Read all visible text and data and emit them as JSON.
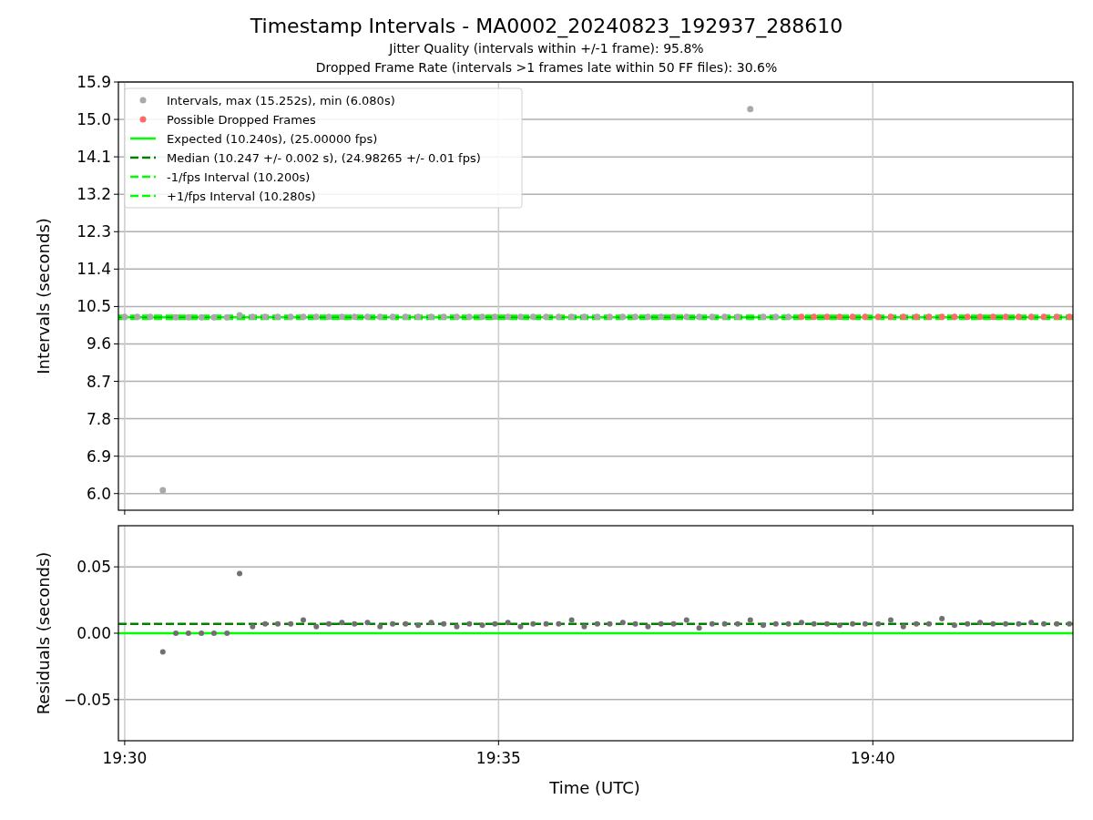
{
  "figure": {
    "title": "Timestamp Intervals - MA0002_20240823_192937_288610",
    "subtitles": [
      "Jitter Quality (intervals within +/-1 frame): 95.8%",
      "Dropped Frame Rate (intervals >1 frames late within 50 FF files): 30.6%"
    ]
  },
  "intervals_plot": {
    "chart_data": {
      "type": "scatter",
      "legend": "upper left",
      "grid": true,
      "ylabel": "Intervals (seconds)",
      "xlim": [
        19.4986,
        19.7113
      ],
      "ylim": [
        5.6,
        15.9
      ],
      "yticks": [
        {
          "value": 6.0,
          "label": "6.0"
        },
        {
          "value": 6.9,
          "label": "6.9"
        },
        {
          "value": 7.8,
          "label": "7.8"
        },
        {
          "value": 8.7,
          "label": "8.7"
        },
        {
          "value": 9.6,
          "label": "9.6"
        },
        {
          "value": 10.5,
          "label": "10.5"
        },
        {
          "value": 11.4,
          "label": "11.4"
        },
        {
          "value": 12.3,
          "label": "12.3"
        },
        {
          "value": 13.2,
          "label": "13.2"
        },
        {
          "value": 14.1,
          "label": "14.1"
        },
        {
          "value": 15.0,
          "label": "15.0"
        },
        {
          "value": 15.9,
          "label": "15.9"
        }
      ],
      "series": [
        {
          "name": "Intervals, max (15.252s), min (6.080s)",
          "color": "#a9a9a9",
          "x": [
            19.5,
            19.5028,
            19.5057,
            19.5085,
            19.5114,
            19.5142,
            19.5171,
            19.5199,
            19.5228,
            19.5256,
            19.5285,
            19.5313,
            19.5341,
            19.537,
            19.5398,
            19.5427,
            19.5455,
            19.5484,
            19.5512,
            19.5541,
            19.5569,
            19.5597,
            19.5626,
            19.5654,
            19.5683,
            19.5711,
            19.574,
            19.5768,
            19.5797,
            19.5825,
            19.5854,
            19.5882,
            19.591,
            19.5939,
            19.5967,
            19.5996,
            19.6024,
            19.6053,
            19.6081,
            19.611,
            19.6138,
            19.6166,
            19.6195,
            19.6223,
            19.6252,
            19.628,
            19.6309,
            19.6337,
            19.6366,
            19.6394,
            19.6423,
            19.6451,
            19.6479
          ],
          "values": [
            10.25,
            10.25,
            10.25,
            6.08,
            10.24,
            10.24,
            10.24,
            10.24,
            10.24,
            10.29,
            10.25,
            10.25,
            10.25,
            10.25,
            10.25,
            10.25,
            10.25,
            10.25,
            10.25,
            10.25,
            10.25,
            10.25,
            10.25,
            10.25,
            10.25,
            10.25,
            10.25,
            10.25,
            10.25,
            10.25,
            10.25,
            10.25,
            10.25,
            10.25,
            10.25,
            10.25,
            10.25,
            10.25,
            10.25,
            10.25,
            10.25,
            10.25,
            10.25,
            10.25,
            10.25,
            10.25,
            10.25,
            10.25,
            10.25,
            15.25,
            10.25,
            10.25,
            10.25
          ]
        },
        {
          "name": "Possible Dropped Frames",
          "color": "#ff6b6b",
          "x": [
            19.6508,
            19.6536,
            19.6565,
            19.6593,
            19.6622,
            19.665,
            19.6679,
            19.6707,
            19.6735,
            19.6764,
            19.6792,
            19.6821,
            19.6849,
            19.6878,
            19.6906,
            19.6935,
            19.6963,
            19.6992,
            19.702,
            19.7048,
            19.7077,
            19.7105
          ],
          "values": [
            10.25,
            10.25,
            10.25,
            10.25,
            10.25,
            10.25,
            10.25,
            10.25,
            10.25,
            10.25,
            10.25,
            10.25,
            10.25,
            10.25,
            10.25,
            10.25,
            10.25,
            10.25,
            10.25,
            10.25,
            10.25,
            10.25
          ]
        }
      ],
      "ref_lines": [
        {
          "axis": "y",
          "value": 10.24,
          "label": "Expected (10.240s), (25.00000 fps)",
          "color": "#00ff00"
        },
        {
          "axis": "y",
          "value": 10.247,
          "label": "Median (10.247 +/- 0.002 s), (24.98265 +/- 0.01 fps)",
          "color": "#008000"
        },
        {
          "axis": "y",
          "value": 10.2,
          "label": "-1/fps Interval (10.200s)",
          "color": "#00ff00"
        },
        {
          "axis": "y",
          "value": 10.28,
          "label": "+1/fps Interval (10.280s)",
          "color": "#00ff00"
        }
      ]
    }
  },
  "residuals_plot": {
    "chart_data": {
      "type": "scatter",
      "grid": true,
      "xlabel": "Time (UTC)",
      "ylabel": "Residuals (seconds)",
      "xlim": [
        19.4986,
        19.7113
      ],
      "ylim": [
        -0.081,
        0.081
      ],
      "xticks": [
        {
          "value": 19.5,
          "label": "19:30"
        },
        {
          "value": 19.5833,
          "label": "19:35"
        },
        {
          "value": 19.6667,
          "label": "19:40"
        }
      ],
      "yticks": [
        {
          "value": -0.05,
          "label": "−0.05"
        },
        {
          "value": 0,
          "label": "0.00"
        },
        {
          "value": 0.05,
          "label": "0.05"
        }
      ],
      "series": [
        {
          "color": "#707070",
          "x": [
            19.5085,
            19.5114,
            19.5142,
            19.5171,
            19.5199,
            19.5228,
            19.5256,
            19.5285,
            19.5313,
            19.5341,
            19.537,
            19.5398,
            19.5427,
            19.5455,
            19.5484,
            19.5512,
            19.5541,
            19.5569,
            19.5597,
            19.5626,
            19.5654,
            19.5683,
            19.5711,
            19.574,
            19.5768,
            19.5797,
            19.5825,
            19.5854,
            19.5882,
            19.591,
            19.5939,
            19.5967,
            19.5996,
            19.6024,
            19.6053,
            19.6081,
            19.611,
            19.6138,
            19.6166,
            19.6195,
            19.6223,
            19.6252,
            19.628,
            19.6309,
            19.6337,
            19.6366,
            19.6394,
            19.6423,
            19.6451,
            19.6479,
            19.6508,
            19.6536,
            19.6565,
            19.6593,
            19.6622,
            19.665,
            19.6679,
            19.6707,
            19.6735,
            19.6764,
            19.6792,
            19.6821,
            19.6849,
            19.6878,
            19.6906,
            19.6935,
            19.6963,
            19.6992,
            19.702,
            19.7048,
            19.7077,
            19.7105
          ],
          "values": [
            -0.014,
            0,
            0,
            0,
            0,
            0,
            0.045,
            0.005,
            0.007,
            0.007,
            0.007,
            0.01,
            0.005,
            0.007,
            0.008,
            0.007,
            0.008,
            0.005,
            0.007,
            0.007,
            0.006,
            0.008,
            0.007,
            0.005,
            0.007,
            0.006,
            0.007,
            0.008,
            0.005,
            0.007,
            0.007,
            0.007,
            0.01,
            0.005,
            0.007,
            0.007,
            0.008,
            0.007,
            0.005,
            0.007,
            0.007,
            0.01,
            0.004,
            0.007,
            0.007,
            0.007,
            0.01,
            0.006,
            0.007,
            0.007,
            0.008,
            0.007,
            0.007,
            0.006,
            0.007,
            0.007,
            0.007,
            0.01,
            0.005,
            0.007,
            0.007,
            0.011,
            0.006,
            0.007,
            0.008,
            0.007,
            0.007,
            0.007,
            0.008,
            0.007,
            0.007,
            0.007
          ]
        }
      ],
      "ref_lines": [
        {
          "axis": "y",
          "value": 0,
          "color": "#00ff00"
        },
        {
          "axis": "y",
          "value": 0.007,
          "color": "#008000"
        }
      ]
    }
  }
}
